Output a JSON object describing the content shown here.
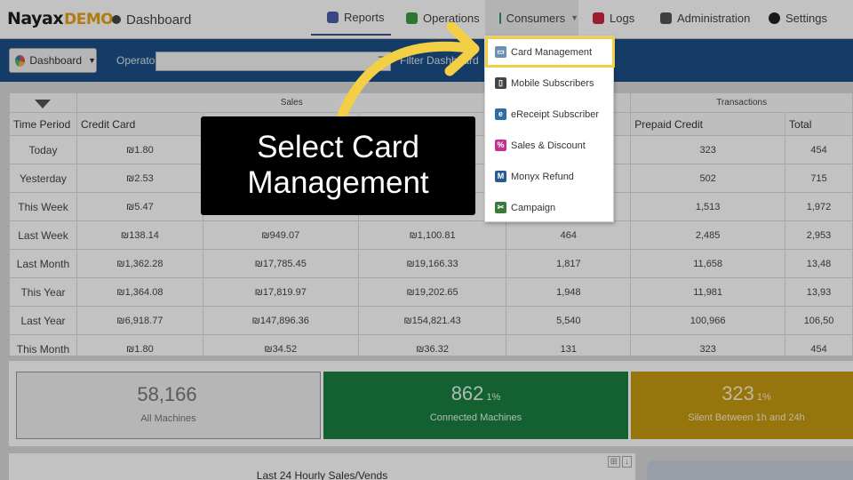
{
  "header": {
    "logo_main": "Nayax",
    "logo_suffix": "DEMO",
    "breadcrumb": "Dashboard",
    "nav": [
      {
        "label": "Reports",
        "icon": "reports-icon",
        "color": "#4a5ea8"
      },
      {
        "label": "Operations",
        "icon": "operations-icon",
        "color": "#3a9a44"
      },
      {
        "label": "Consumers",
        "icon": "consumers-icon",
        "color": "#2f8e7a"
      },
      {
        "label": "Logs",
        "icon": "logs-icon",
        "color": "#c8283c"
      },
      {
        "label": "Administration",
        "icon": "administration-icon",
        "color": "#555555"
      },
      {
        "label": "Settings",
        "icon": "settings-icon",
        "color": "#222222"
      }
    ]
  },
  "toolbar": {
    "dashboard_label": "Dashboard",
    "operator_label": "Operator",
    "operator_value": "",
    "filter_label": "Filter Dashboard"
  },
  "table": {
    "groups": {
      "sales": "Sales",
      "transactions": "Transactions"
    },
    "columns": [
      "Time Period",
      "Credit Card",
      "",
      "",
      "",
      "Prepaid Credit",
      "Total"
    ],
    "rows": [
      [
        "Today",
        "₪1.80",
        "",
        "",
        "",
        "323",
        "454"
      ],
      [
        "Yesterday",
        "₪2.53",
        "",
        "",
        "",
        "502",
        "715"
      ],
      [
        "This Week",
        "₪5.47",
        "",
        "",
        "",
        "1,513",
        "1,972"
      ],
      [
        "Last Week",
        "₪138.14",
        "₪949.07",
        "₪1,100.81",
        "464",
        "2,485",
        "2,953"
      ],
      [
        "Last Month",
        "₪1,362.28",
        "₪17,785.45",
        "₪19,166.33",
        "1,817",
        "11,658",
        "13,48"
      ],
      [
        "This Year",
        "₪1,364.08",
        "₪17,819.97",
        "₪19,202.65",
        "1,948",
        "11,981",
        "13,93"
      ],
      [
        "Last Year",
        "₪6,918.77",
        "₪147,896.36",
        "₪154,821.43",
        "5,540",
        "100,966",
        "106,50"
      ],
      [
        "This Month",
        "₪1.80",
        "₪34.52",
        "₪36.32",
        "131",
        "323",
        "454"
      ]
    ]
  },
  "cards": [
    {
      "value": "58,166",
      "percent": "",
      "label": "All Machines"
    },
    {
      "value": "862",
      "percent": "1%",
      "label": "Connected Machines"
    },
    {
      "value": "323",
      "percent": "1%",
      "label": "Silent Between 1h and 24h"
    }
  ],
  "bottom_panel": {
    "title": "Last 24 Hourly Sales/Vends"
  },
  "consumers_menu": [
    {
      "label": "Card Management",
      "icon": "card-management-icon",
      "color": "#6b8fb5",
      "glyph": "▭"
    },
    {
      "label": "Mobile Subscribers",
      "icon": "mobile-subscribers-icon",
      "color": "#444444",
      "glyph": "▯"
    },
    {
      "label": "eReceipt Subscriber",
      "icon": "ereceipt-icon",
      "color": "#2e6da4",
      "glyph": "e"
    },
    {
      "label": "Sales & Discount",
      "icon": "sales-discount-icon",
      "color": "#c2338f",
      "glyph": "%"
    },
    {
      "label": "Monyx Refund",
      "icon": "monyx-refund-icon",
      "color": "#2a5b8c",
      "glyph": "M"
    },
    {
      "label": "Campaign",
      "icon": "campaign-icon",
      "color": "#3a7a3a",
      "glyph": "✂"
    }
  ],
  "callout": {
    "line1": "Select Card",
    "line2": "Management"
  },
  "colors": {
    "accent_yellow": "#f2cf45",
    "toolbar_blue": "#1b4f86",
    "connected_green": "#198040",
    "silent_amber": "#c79a12"
  }
}
